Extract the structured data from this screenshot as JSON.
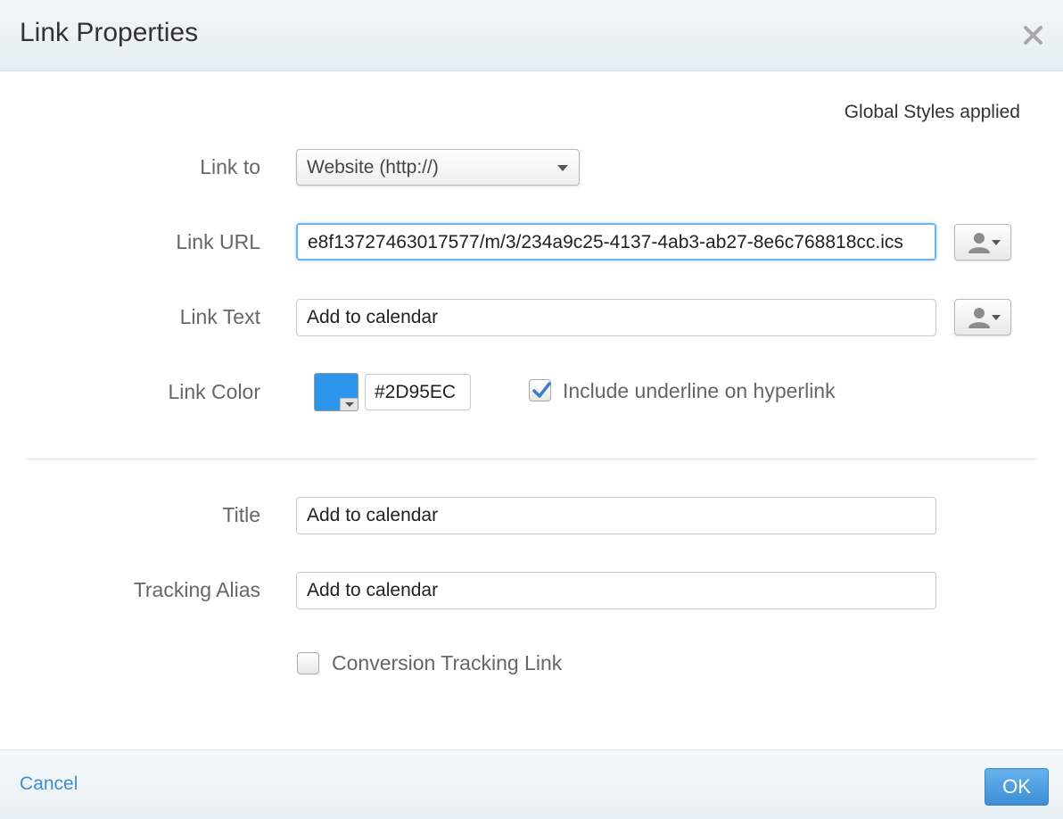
{
  "dialog": {
    "title": "Link Properties",
    "global_styles": "Global Styles applied"
  },
  "link_to": {
    "label": "Link to",
    "value": "Website (http://)"
  },
  "link_url": {
    "label": "Link URL",
    "value": "e8f13727463017577/m/3/234a9c25-4137-4ab3-ab27-8e6c768818cc.ics"
  },
  "link_text": {
    "label": "Link Text",
    "value": "Add to calendar"
  },
  "link_color": {
    "label": "Link Color",
    "hex": "#2D95EC",
    "swatch_color": "#2D95EC",
    "underline_label": "Include underline on hyperlink",
    "underline_checked": true
  },
  "title_field": {
    "label": "Title",
    "value": "Add to calendar"
  },
  "tracking_alias": {
    "label": "Tracking Alias",
    "value": "Add to calendar"
  },
  "conversion": {
    "label": "Conversion Tracking Link",
    "checked": false
  },
  "footer": {
    "cancel_label": "Cancel",
    "ok_label": "OK"
  },
  "icons": {
    "close": "close-icon",
    "person": "person-icon",
    "caret": "caret-down-icon",
    "check": "checkmark-icon"
  }
}
